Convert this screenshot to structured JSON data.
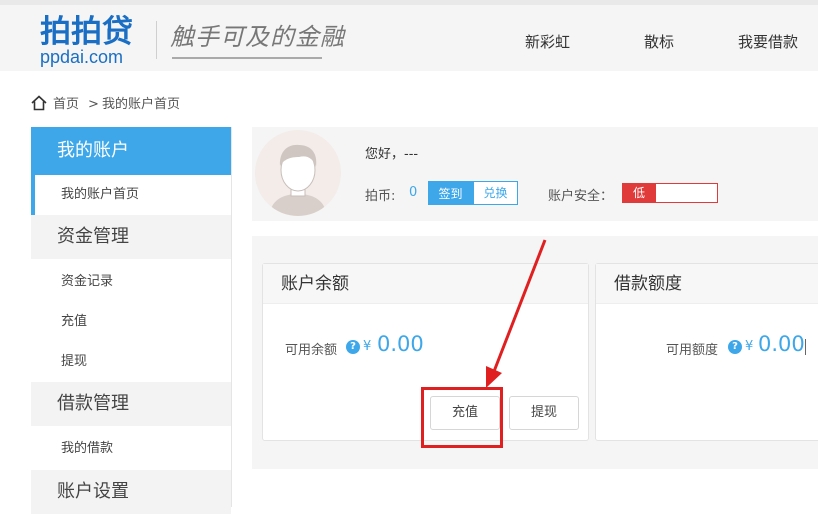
{
  "header": {
    "logo_main": "拍拍贷",
    "logo_sub": "ppdai.com",
    "slogan": "触手可及的金融",
    "nav": [
      "新彩虹",
      "散标",
      "我要借款"
    ]
  },
  "breadcrumb": {
    "home": "首页",
    "sep": ">",
    "current": "我的账户首页"
  },
  "sidebar": {
    "head": "我的账户",
    "items": [
      {
        "label": "我的账户首页",
        "type": "item",
        "active": true
      },
      {
        "label": "资金管理",
        "type": "group"
      },
      {
        "label": "资金记录",
        "type": "item"
      },
      {
        "label": "充值",
        "type": "item"
      },
      {
        "label": "提现",
        "type": "item"
      },
      {
        "label": "借款管理",
        "type": "group"
      },
      {
        "label": "我的借款",
        "type": "item"
      },
      {
        "label": "账户设置",
        "type": "group"
      }
    ]
  },
  "profile": {
    "greeting": "您好，---",
    "coin_label": "拍币:",
    "coin_value": "0",
    "sign_label": "签到",
    "exchange_label": "兑换",
    "security_label": "账户安全：",
    "security_level": "低",
    "security_percent": 35
  },
  "balance_card": {
    "title": "账户余额",
    "avail_label": "可用余额",
    "currency": "¥",
    "amount": "0.00",
    "recharge_label": "充值",
    "withdraw_label": "提现"
  },
  "credit_card": {
    "title": "借款额度",
    "avail_label": "可用额度",
    "currency": "¥",
    "amount": "0.00"
  },
  "colors": {
    "accent": "#3da7ea",
    "danger": "#e03a3a",
    "annotation": "#e02020"
  }
}
